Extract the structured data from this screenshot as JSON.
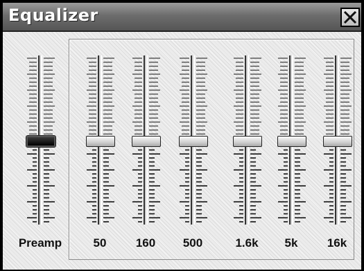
{
  "window": {
    "title": "Equalizer",
    "close_icon": "close-x-icon"
  },
  "preamp": {
    "label": "Preamp",
    "level": 0.5,
    "selected": true
  },
  "bands": [
    {
      "label": "50",
      "level": 0.5
    },
    {
      "label": "160",
      "level": 0.5
    },
    {
      "label": "500",
      "level": 0.5
    },
    {
      "label": "1.6k",
      "level": 0.5
    },
    {
      "label": "5k",
      "level": 0.5
    },
    {
      "label": "16k",
      "level": 0.5
    }
  ],
  "colors": {
    "titlebar": "#6d6d6d",
    "panel": "#ececec",
    "thumb_selected": "#000000"
  }
}
